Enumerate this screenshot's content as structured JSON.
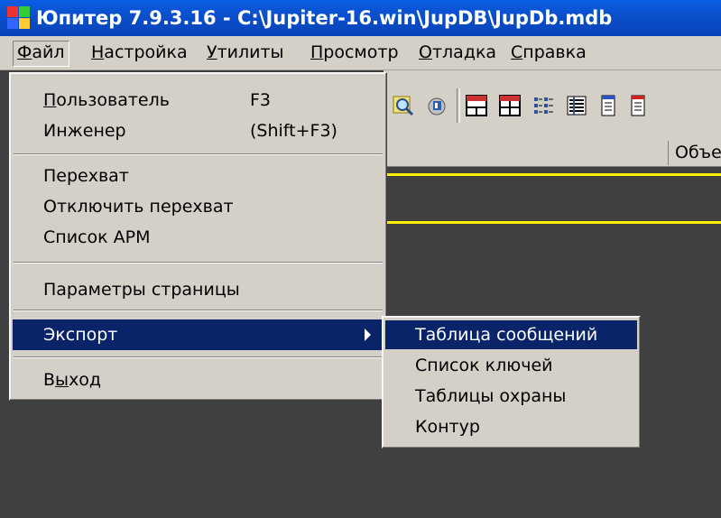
{
  "window": {
    "title": "Юпитер 7.9.3.16  -  C:\\Jupiter-16.win\\JupDB\\JupDb.mdb"
  },
  "menubar": {
    "items": [
      {
        "pre": "",
        "u": "Ф",
        "post": "айл"
      },
      {
        "pre": "",
        "u": "Н",
        "post": "астройка"
      },
      {
        "pre": "",
        "u": "У",
        "post": "тилиты"
      },
      {
        "pre": "",
        "u": "П",
        "post": "росмотр"
      },
      {
        "pre": "",
        "u": "О",
        "post": "тладка"
      },
      {
        "pre": "",
        "u": "С",
        "post": "правка"
      }
    ]
  },
  "file_menu": {
    "user": {
      "pre": "",
      "u": "П",
      "post": "ользователь",
      "shortcut": "F3"
    },
    "engineer": {
      "label": "Инженер",
      "shortcut": "(Shift+F3)"
    },
    "capture": "Перехват",
    "disable_capture": "Отключить перехват",
    "arm_list": "Список АРМ",
    "page_params": "Параметры страницы",
    "export": "Экспорт",
    "exit": {
      "pre": "В",
      "u": "ы",
      "post": "ход"
    }
  },
  "export_submenu": {
    "items": [
      "Таблица сообщений",
      "Список ключей",
      "Таблицы охраны",
      "Контур"
    ]
  },
  "table": {
    "column_header": "Объе"
  },
  "colors": {
    "selection": "#0a246a",
    "menu_bg": "#d4d0c8",
    "workspace": "#404040",
    "highlight_line": "#fff200"
  }
}
